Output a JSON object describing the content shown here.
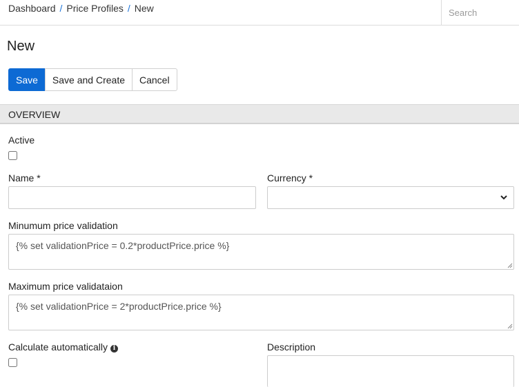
{
  "breadcrumb": {
    "items": [
      "Dashboard",
      "Price Profiles",
      "New"
    ],
    "separator": "/"
  },
  "search": {
    "placeholder": "Search",
    "value": ""
  },
  "page": {
    "title": "New"
  },
  "toolbar": {
    "save_label": "Save",
    "save_create_label": "Save and Create",
    "cancel_label": "Cancel"
  },
  "section": {
    "title": "OVERVIEW"
  },
  "form": {
    "active": {
      "label": "Active",
      "checked": false
    },
    "name": {
      "label": "Name *",
      "value": ""
    },
    "currency": {
      "label": "Currency *",
      "selected": ""
    },
    "min_validation": {
      "label": "Minumum price validation",
      "value": "{% set validationPrice = 0.2*productPrice.price %}"
    },
    "max_validation": {
      "label": "Maximum price validataion",
      "value": "{% set validationPrice = 2*productPrice.price %}"
    },
    "calc_auto": {
      "label": "Calculate automatically",
      "checked": false,
      "info_icon": "info-icon"
    },
    "description": {
      "label": "Description",
      "value": ""
    }
  },
  "colors": {
    "primary": "#0d6ad4",
    "breadcrumb_separator": "#1a73d9",
    "section_bg": "#e9e9e9"
  }
}
